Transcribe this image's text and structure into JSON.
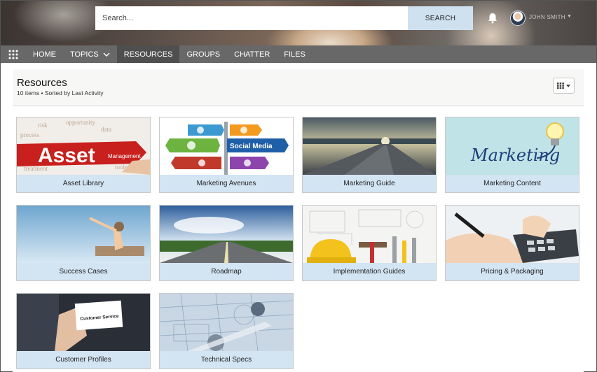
{
  "header": {
    "search_placeholder": "Search...",
    "search_button": "SEARCH",
    "user_name": "JOHN SMITH",
    "notifications_icon": "bell-icon"
  },
  "nav": {
    "items": [
      {
        "label": "HOME"
      },
      {
        "label": "TOPICS"
      },
      {
        "label": "RESOURCES"
      },
      {
        "label": "GROUPS"
      },
      {
        "label": "CHATTER"
      },
      {
        "label": "FILES"
      }
    ],
    "active": "RESOURCES"
  },
  "page": {
    "title": "Resources",
    "subtitle": "10 items • Sorted by Last Activity"
  },
  "tiles": [
    {
      "label": "Asset Library",
      "image_text": "Asset",
      "image_text2": "Management"
    },
    {
      "label": "Marketing Avenues",
      "image_text": "Social Media"
    },
    {
      "label": "Marketing Guide"
    },
    {
      "label": "Marketing Content",
      "image_text": "Marketing"
    },
    {
      "label": "Success Cases"
    },
    {
      "label": "Roadmap"
    },
    {
      "label": "Implementation Guides"
    },
    {
      "label": "Pricing & Packaging"
    },
    {
      "label": "Customer Profiles",
      "image_text": "Customer Service"
    },
    {
      "label": "Technical Specs"
    }
  ],
  "colors": {
    "nav_bg": "#606060",
    "tile_label_bg": "#d3e4f2",
    "search_button_bg": "#cfe0ef"
  }
}
